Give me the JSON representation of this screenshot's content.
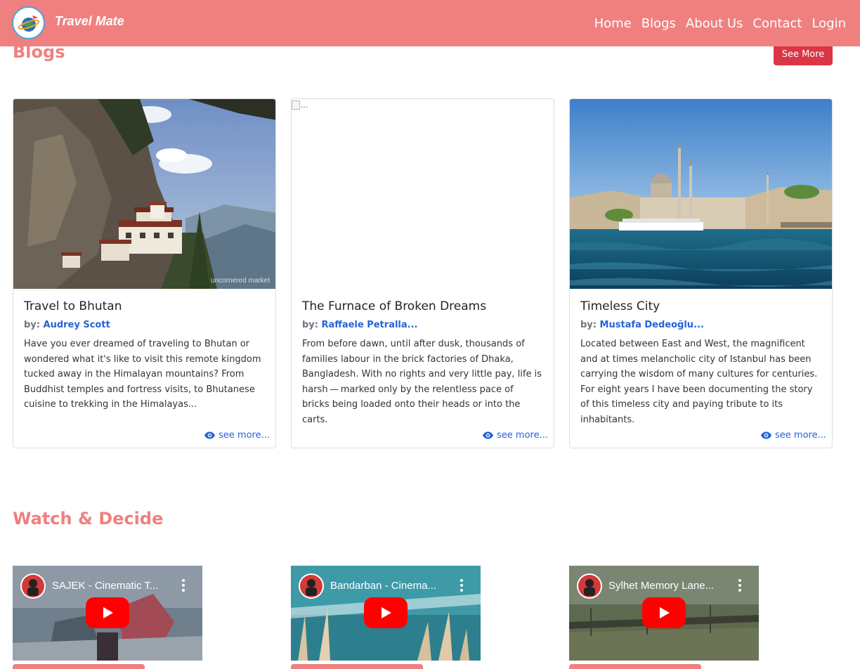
{
  "header": {
    "brand": "Travel Mate",
    "nav": [
      "Home",
      "Blogs",
      "About Us",
      "Contact",
      "Login"
    ]
  },
  "blogs": {
    "title": "Blogs",
    "see_more": "See More",
    "cards": [
      {
        "title": "Travel to Bhutan",
        "by": "by:",
        "author": "Audrey Scott",
        "text": "Have you ever dreamed of traveling to Bhutan or wondered what it's like to visit this remote kingdom tucked away in the Himalayan mountains? From Buddhist temples and fortress visits, to Bhutanese cuisine to trekking in the Himalayas...",
        "more": "see more...",
        "watermark": "uncornered market"
      },
      {
        "title": "The Furnace of Broken Dreams",
        "by": "by:",
        "author": "Raffaele Petralla...",
        "text": "From before dawn, until after dusk, thousands of families labour in the brick factories of Dhaka, Bangladesh. With no rights and very little pay, life is harsh — marked only by the relentless pace of bricks being loaded onto their heads or into the carts.",
        "more": "see more...",
        "image_alt": "..."
      },
      {
        "title": "Timeless City",
        "by": "by:",
        "author": "Mustafa Dedeoğlu...",
        "text": "Located between East and West, the magnificent and at times melancholic city of Istanbul has been carrying the wisdom of many cultures for centuries. For eight years I have been documenting the story of this timeless city and paying tribute to its inhabitants.",
        "more": "see more..."
      }
    ]
  },
  "watch": {
    "title": "Watch & Decide",
    "videos": [
      {
        "title": "SAJEK - Cinematic T..."
      },
      {
        "title": "Bandarban - Cinema..."
      },
      {
        "title": "Sylhet Memory Lane..."
      }
    ]
  },
  "colors": {
    "accent": "#f08080",
    "see_more_button": "#dc3545",
    "link": "#2563d8",
    "youtube_red": "#ff0000"
  },
  "icons": {
    "logo": "globe-plane-icon",
    "see_more": "eye-icon",
    "video_play": "youtube-play-icon",
    "video_menu": "kebab-menu-icon"
  }
}
